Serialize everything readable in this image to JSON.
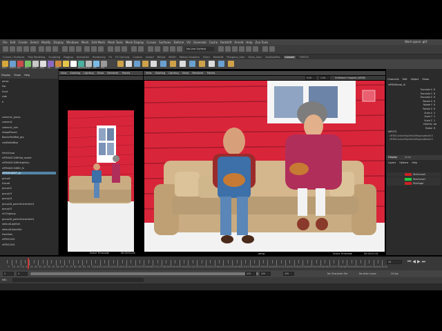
{
  "title_fragment": "Work space:  gitf",
  "menu": [
    "File",
    "Edit",
    "Create",
    "Select",
    "Modify",
    "Display",
    "Windows",
    "Mesh",
    "Edit Mesh",
    "Mesh Tools",
    "Mesh Display",
    "Curves",
    "Surfaces",
    "Deform",
    "UV",
    "Generate",
    "Cache",
    "Redshift",
    "Arnold",
    "Help",
    "Zoo Tools"
  ],
  "live_surface": "No Live Surface",
  "shelf_tabs": [
    "Curves / Surfaces",
    "Poly Modeling",
    "Sculpting",
    "Rigging",
    "Animation",
    "Rendering",
    "FX",
    "FX Caching",
    "Custom",
    "Arnold",
    "Bifrost",
    "MASH",
    "Motion Graphics",
    "XGen",
    "Redshift",
    "Polygons_User",
    "XGen_User",
    "ZooToolsPro",
    "Custom",
    "TURTLE"
  ],
  "active_shelf_tab": "Custom",
  "shelf_labels": [
    "Anim",
    "Deform",
    "Key",
    "Mtrx",
    "Dual",
    "Pose",
    "Vis",
    "Path",
    "",
    "",
    "Redshift",
    "Quad",
    "FPS",
    "Hud"
  ],
  "outliner": {
    "menu": [
      "Display",
      "Show",
      "Help"
    ],
    "items": [
      "persp",
      "top",
      "front",
      "side",
      "tl",
      "",
      "",
      "camera1_group",
      "camera1",
      "camera1_aim",
      "imagePlane1",
      "BackinRedRed_grp",
      "nodDoNotBox",
      "",
      "HectGroup",
      "nfFBXASC046Hipt_model",
      "nfFBXASC046Heightlev",
      "nfFBXASC046ftr_fx",
      "nfFBXFuDIGT_gr",
      "group5",
      "Extra8",
      "group12",
      "group13",
      "group14",
      "group16_parentConstraint1",
      "group15",
      "nf120group",
      "group16_parentConstraint1",
      "defaultLightSet",
      "defaultObjectSet",
      "HectSets",
      "nfFBX1245",
      "nfFBX1245"
    ],
    "selected_index": 18
  },
  "cam_panel": {
    "menu": [
      "View",
      "Shading",
      "Lighting",
      "Show",
      "Renderer",
      "Panels"
    ],
    "hud_timecode_label": "Scene Timecode",
    "hud_timecode": "00:00:01:04"
  },
  "persp_panel": {
    "menu": [
      "View",
      "Shading",
      "Lighting",
      "Show",
      "Renderer",
      "Panels"
    ],
    "near": "0.00",
    "far": "1.00",
    "colorspace": "Unitstone mapped (sRGB)",
    "camera_label": "persp",
    "hud_timecode_label": "Scene Timecode",
    "hud_timecode": "00:00:01:04"
  },
  "channel_box": {
    "menu": [
      "Channels",
      "Edit",
      "Object",
      "Show"
    ],
    "object": "nfFBXShowl_l4",
    "attrs": [
      {
        "name": "Translate X",
        "value": "0"
      },
      {
        "name": "Translate Y",
        "value": "0"
      },
      {
        "name": "Translate Z",
        "value": "0"
      },
      {
        "name": "Rotate X",
        "value": "0"
      },
      {
        "name": "Rotate Y",
        "value": "0"
      },
      {
        "name": "Rotate Z",
        "value": "0"
      },
      {
        "name": "Scale X",
        "value": "1"
      },
      {
        "name": "Scale Y",
        "value": "1"
      },
      {
        "name": "Scale Z",
        "value": "1"
      },
      {
        "name": "Visibility",
        "value": "on"
      },
      {
        "name": "Global",
        "value": "0"
      }
    ],
    "inputs_header": "INPUTS",
    "inputs": [
      "nfFBXCushionRigDefaultMappingNode15",
      "nfFBXCushionRigDefaultMappingNode15"
    ],
    "layer_tabs": [
      "Display",
      "Anim"
    ],
    "layer_menu": [
      "Layers",
      "Options",
      "Help"
    ],
    "layers": [
      {
        "name": "SkinCurve2",
        "color": "#cc2222"
      },
      {
        "name": "SkinCurve1",
        "color": "#22cc44"
      },
      {
        "name": "SkinCage",
        "color": "#cc2222"
      }
    ]
  },
  "timeline": {
    "ticks": [
      "5",
      "10",
      "15",
      "20",
      "25",
      "30",
      "35",
      "40",
      "45",
      "50",
      "55",
      "60",
      "65",
      "70",
      "75",
      "80",
      "85",
      "90",
      "95",
      "100",
      "105",
      "110",
      "115",
      "120",
      "125",
      "130",
      "135",
      "140",
      "145",
      "150",
      "155",
      "160",
      "165",
      "170",
      "175",
      "180",
      "185",
      "190",
      "195",
      "200",
      "205",
      "210",
      "215",
      "220",
      "225",
      "230",
      "235",
      "240",
      "245",
      "250",
      "255",
      "260",
      "265",
      "270",
      "275",
      "280",
      "285",
      "290",
      "295",
      "300",
      "305",
      "310",
      "315",
      "320",
      "325",
      "330",
      "335",
      "340",
      "345",
      "350",
      "355",
      "360",
      "365",
      "370",
      "375",
      "380",
      "385",
      "390",
      "395",
      "400",
      "405",
      "410",
      "415",
      "420",
      "425",
      "430"
    ],
    "current_frame": "28",
    "playhead_frame": 28
  },
  "range": {
    "start": "0",
    "inner_start": "0",
    "inner_end": "439",
    "end1": "439",
    "end2": "439",
    "character_set": "No Character Set",
    "anim_layer": "No Anim Layer",
    "fps": "24 fps"
  },
  "cmd": {
    "lang": "MEL"
  },
  "colors": {
    "wall": "#d9253a",
    "wall_dark": "#a11a2b",
    "floor": "#f2f2f2",
    "sofa": "#c9ac82",
    "sofa_dark": "#9c8260",
    "overalls": "#3d6fa8",
    "plaid": "#9b2b2b",
    "dress": "#b02e5a",
    "selection": "#5285a6"
  }
}
